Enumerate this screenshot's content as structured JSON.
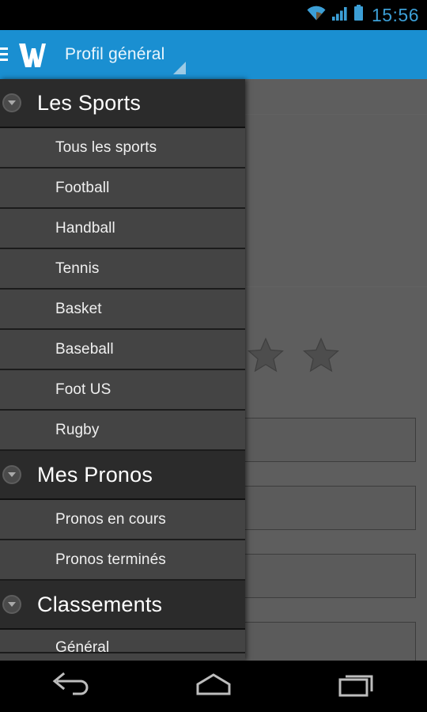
{
  "status_bar": {
    "time": "15:56",
    "icons": [
      "wifi-icon",
      "cellular-signal-icon",
      "battery-icon"
    ],
    "accent_color": "#3c9fd6",
    "background": "#000000"
  },
  "app_bar": {
    "menu_icon": "hamburger-menu-icon",
    "logo": "w-logo",
    "title": "Profil général",
    "spinner_icon": "dropdown-caret-icon",
    "background": "#1a8fd1"
  },
  "drawer": {
    "background": "#444444",
    "header_background": "#2b2b2b",
    "groups": [
      {
        "label": "Les Sports",
        "toggle_icon": "chevron-down-circle-icon",
        "items": [
          {
            "label": "Tous les sports"
          },
          {
            "label": "Football"
          },
          {
            "label": "Handball"
          },
          {
            "label": "Tennis"
          },
          {
            "label": "Basket"
          },
          {
            "label": "Baseball"
          },
          {
            "label": "Foot US"
          },
          {
            "label": "Rugby"
          }
        ]
      },
      {
        "label": "Mes Pronos",
        "toggle_icon": "chevron-down-circle-icon",
        "items": [
          {
            "label": "Pronos en cours"
          },
          {
            "label": "Pronos terminés"
          }
        ]
      },
      {
        "label": "Classements",
        "toggle_icon": "chevron-down-circle-icon",
        "items": [
          {
            "label": "Général"
          }
        ]
      }
    ]
  },
  "content": {
    "scrim_color": "#5e5e5e",
    "rating_stars": [
      "star-icon",
      "star-icon"
    ],
    "cards": [
      {
        "name": "content-card"
      },
      {
        "name": "content-card"
      },
      {
        "name": "content-card"
      },
      {
        "name": "content-card"
      }
    ]
  },
  "nav_bar": {
    "background": "#000000",
    "buttons": [
      {
        "icon": "back-arrow-icon"
      },
      {
        "icon": "home-icon"
      },
      {
        "icon": "recents-icon"
      }
    ]
  }
}
